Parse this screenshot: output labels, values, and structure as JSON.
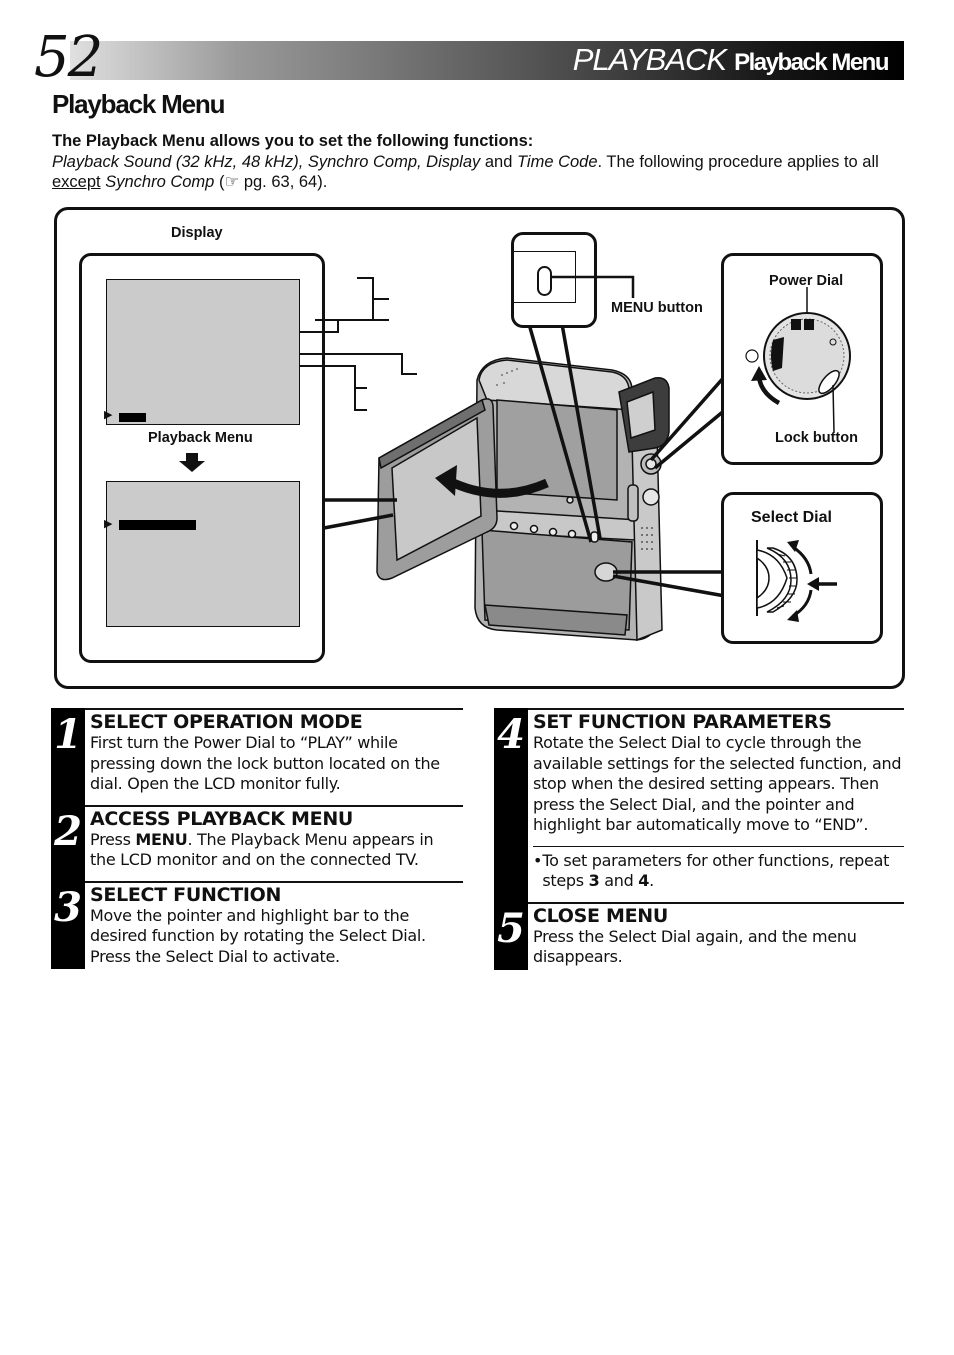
{
  "header": {
    "page_number": "52",
    "section": "PLAYBACK",
    "subsection": "Playback Menu"
  },
  "page_title": "Playback Menu",
  "intro": {
    "lead": "The Playback Menu allows you to set the following functions:",
    "func_1": "Playback Sound (32 kHz, 48 kHz), Synchro Comp, Display",
    "and_1": " and ",
    "func_2": "Time Code",
    "text_1": ". The following procedure applies to all ",
    "except": "except",
    "space": " ",
    "func_3": "Synchro Comp",
    "ref_open": " (",
    "ref_icon": "☞",
    "ref_pages": " pg. 63, 64)."
  },
  "diagram": {
    "display_label": "Display",
    "playback_menu_label": "Playback Menu",
    "menu_button_label": "MENU button",
    "power_dial_label": "Power Dial",
    "lock_button_label": "Lock button",
    "select_dial_label": "Select Dial",
    "colors": {
      "lcd": "#cbcbcb",
      "body_light": "#d2d2d2",
      "body_mid": "#a8a8a8",
      "body_dark": "#7a7a7a"
    }
  },
  "steps": [
    {
      "number": "1",
      "title": "SELECT OPERATION MODE",
      "text": "First turn the Power Dial to “PLAY” while pressing down the lock button located on the dial. Open the LCD monitor fully."
    },
    {
      "number": "2",
      "title": "ACCESS PLAYBACK MENU",
      "text_pre": "Press ",
      "text_bold": "MENU",
      "text_post": ". The Playback Menu appears in the LCD monitor and on the connected TV."
    },
    {
      "number": "3",
      "title": "SELECT FUNCTION",
      "text": "Move the pointer and highlight bar to the desired function by rotating the Select Dial. Press the Select Dial to activate."
    },
    {
      "number": "4",
      "title": "SET FUNCTION PARAMETERS",
      "text": "Rotate the Select Dial to cycle through the available settings for the selected function, and stop when the desired setting appears. Then press the Select Dial, and the pointer and highlight bar automatically move to “END”.",
      "note": {
        "bullet": "•",
        "pre": "To set parameters for other functions, repeat steps ",
        "b1": "3",
        "mid": " and ",
        "b2": "4",
        "post": "."
      }
    },
    {
      "number": "5",
      "title": "CLOSE MENU",
      "text": "Press the Select Dial again, and the menu disappears."
    }
  ]
}
